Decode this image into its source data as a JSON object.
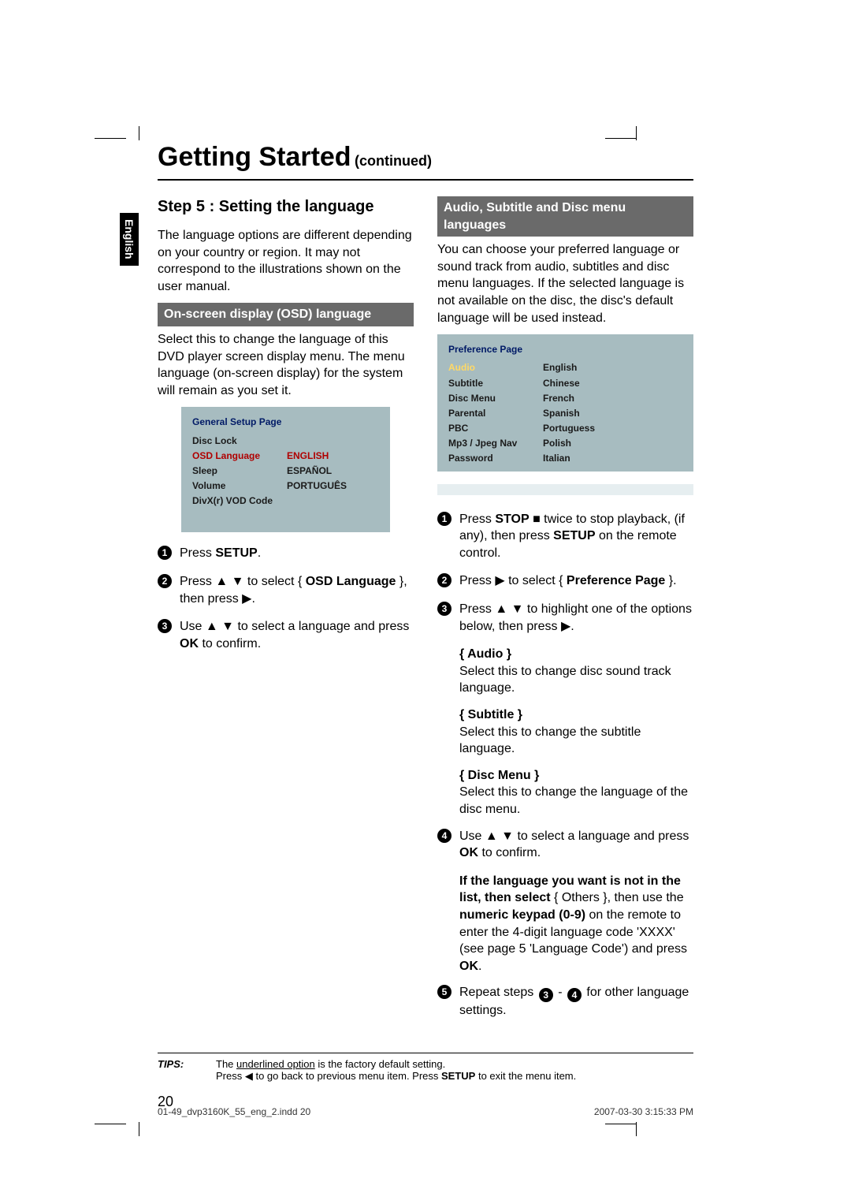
{
  "title": "Getting Started",
  "continued": "(continued)",
  "lang_tab": "English",
  "step_heading": "Step 5 : Setting the language",
  "intro_para": "The language options are different depending on your country or region. It may not correspond to the illustrations shown on the user manual.",
  "section_osd": "On-screen display (OSD) language",
  "osd_para": "Select this to change the language of this DVD player screen display menu. The menu language (on-screen display) for the system will remain as you set it.",
  "osd_box": {
    "title": "General Setup Page",
    "rows": [
      {
        "label": "Disc Lock",
        "val": ""
      },
      {
        "label": "OSD Language",
        "val": "ENGLISH",
        "sel": true
      },
      {
        "label": "Sleep",
        "val": "ESPAÑOL"
      },
      {
        "label": "Volume",
        "val": "PORTUGUÊS"
      },
      {
        "label": "DivX(r) VOD Code",
        "val": ""
      }
    ]
  },
  "osd_steps": [
    {
      "n": "1",
      "html": "Press <b>SETUP</b>."
    },
    {
      "n": "2",
      "html": "Press ▲ ▼ to select { <b>OSD Language</b> }, then press ▶."
    },
    {
      "n": "3",
      "html": "Use ▲ ▼ to select a language and press <b>OK</b> to confirm."
    }
  ],
  "section_pref": "Audio, Subtitle and Disc menu languages",
  "pref_para": "You can choose your preferred language or sound track from audio, subtitles and disc menu languages. If the selected language is not available on the disc, the disc's default language will be used instead.",
  "pref_box": {
    "title": "Preference Page",
    "rows": [
      {
        "label": "Audio",
        "val": "English",
        "sel": true
      },
      {
        "label": "Subtitle",
        "val": "Chinese"
      },
      {
        "label": "Disc Menu",
        "val": "French"
      },
      {
        "label": "Parental",
        "val": "Spanish"
      },
      {
        "label": "PBC",
        "val": "Portuguess"
      },
      {
        "label": "Mp3 / Jpeg Nav",
        "val": "Polish"
      },
      {
        "label": "Password",
        "val": "Italian"
      }
    ]
  },
  "pref_steps": [
    {
      "n": "1",
      "html": "Press <b>STOP</b> ■ twice to stop playback, (if any), then press <b>SETUP</b> on the remote control."
    },
    {
      "n": "2",
      "html": "Press ▶ to select { <b>Preference Page</b> }."
    },
    {
      "n": "3",
      "html": "Press ▲ ▼ to highlight one of the options below, then press ▶."
    }
  ],
  "options": [
    {
      "head": "{ Audio }",
      "body": "Select this to change disc sound track language."
    },
    {
      "head": "{ Subtitle }",
      "body": "Select this to change the subtitle language."
    },
    {
      "head": "{ Disc Menu }",
      "body": "Select this to change the language of the disc menu."
    }
  ],
  "pref_step4": "Use ▲ ▼ to select a language and press <b>OK</b> to confirm.",
  "pref_note": "<b>If the language you want is not in the list, then select</b> { Others }, then use the <b>numeric keypad (0-9)</b> on the remote to enter the 4-digit language code 'XXXX' (see page 5 'Language Code') and press <b>OK</b>.",
  "pref_step5_pre": "Repeat steps ",
  "pref_step5_post": " for other language settings.",
  "tips_label": "TIPS:",
  "tips_line1_a": "The ",
  "tips_line1_u": "underlined option",
  "tips_line1_b": " is the factory default setting.",
  "tips_line2": "Press ◀ to go back to previous menu item. Press <b>SETUP</b> to exit the menu item.",
  "page_number": "20",
  "footer_left": "01-49_dvp3160K_55_eng_2.indd   20",
  "footer_right": "2007-03-30   3:15:33 PM"
}
